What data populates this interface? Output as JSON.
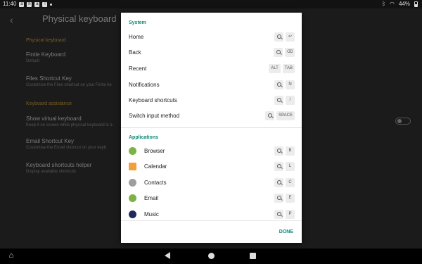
{
  "status_bar": {
    "time": "11:40",
    "icons_left": [
      "a-icon",
      "h-icon",
      "a-icon",
      "notification-icon",
      "dot-icon"
    ],
    "battery": "44%"
  },
  "background": {
    "title": "Physical keyboard",
    "section_physical": "Physical keyboard",
    "row1_title": "Fintie Keyboard",
    "row1_sub": "Default",
    "row2_title": "Files Shortcut Key",
    "row2_sub": "Customise the Files shortcut on your Fintie ke",
    "section_assist": "Keyboard assistance",
    "row3_title": "Show virtual keyboard",
    "row3_sub": "Keep it on screen while physical keyboard is a",
    "row4_title": "Email Shortcut Key",
    "row4_sub": "Customise the Email shortcut on your keyb",
    "row5_title": "Keyboard shortcuts helper",
    "row5_sub": "Display available shortcuts"
  },
  "dialog": {
    "system_title": "System",
    "system": [
      {
        "label": "Home",
        "keys": [
          "search",
          "↩"
        ]
      },
      {
        "label": "Back",
        "keys": [
          "search",
          "⌫"
        ]
      },
      {
        "label": "Recent",
        "keys": [
          "ALT",
          "TAB"
        ]
      },
      {
        "label": "Notifications",
        "keys": [
          "search",
          "N"
        ]
      },
      {
        "label": "Keyboard shortcuts",
        "keys": [
          "search",
          "/"
        ]
      },
      {
        "label": "Switch input method",
        "keys": [
          "search",
          "SPACE"
        ]
      }
    ],
    "applications_title": "Applications",
    "applications": [
      {
        "label": "Browser",
        "icon": "browser-icon",
        "color": "#7cb342",
        "keys": [
          "search",
          "B"
        ]
      },
      {
        "label": "Calendar",
        "icon": "calendar-icon",
        "color": "#f4a03a",
        "keys": [
          "search",
          "L"
        ]
      },
      {
        "label": "Contacts",
        "icon": "contacts-icon",
        "color": "#9e9e9e",
        "keys": [
          "search",
          "C"
        ]
      },
      {
        "label": "Email",
        "icon": "email-icon",
        "color": "#7cb342",
        "keys": [
          "search",
          "E"
        ]
      },
      {
        "label": "Music",
        "icon": "music-icon",
        "color": "#1f2a5a",
        "keys": [
          "search",
          "P"
        ]
      }
    ],
    "done_label": "DONE"
  },
  "colors": {
    "accent": "#0f8a78",
    "bg_section": "#7a5f22"
  }
}
